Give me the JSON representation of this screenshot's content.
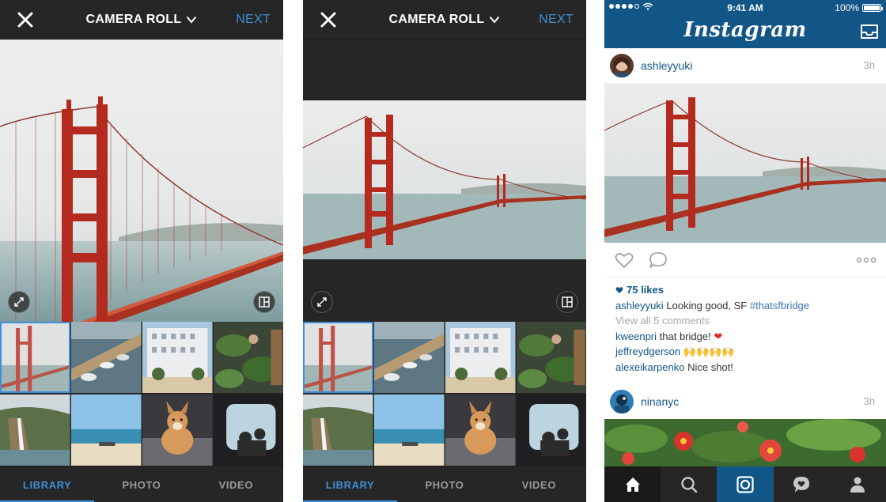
{
  "editor": {
    "title": "CAMERA ROLL",
    "next_label": "NEXT",
    "tabs": [
      {
        "label": "LIBRARY",
        "active": true
      },
      {
        "label": "PHOTO",
        "active": false
      },
      {
        "label": "VIDEO",
        "active": false
      }
    ],
    "icons": {
      "close": "close-icon",
      "title_dropdown": "chevron-down-icon",
      "expand": "expand-icon",
      "layout": "layout-icon"
    }
  },
  "feed": {
    "status_bar": {
      "time": "9:41 AM",
      "battery": "100%"
    },
    "app_name": "Instagram",
    "post1": {
      "username": "ashleyyuki",
      "time_ago": "3h",
      "likes": "75 likes",
      "caption_user": "ashleyyuki",
      "caption_text": "Looking good, SF",
      "caption_hashtag": "#thatsfbridge",
      "view_comments": "View all 5 comments",
      "comments": [
        {
          "user": "kweenpri",
          "text": "that bridge!",
          "emoji": "❤"
        },
        {
          "user": "jeffreydgerson",
          "text": "",
          "emoji": "🙌🙌🙌🙌"
        },
        {
          "user": "alexeikarpenko",
          "text": "Nice shot!",
          "emoji": ""
        }
      ]
    },
    "post2": {
      "username": "ninanyc",
      "time_ago": "3h"
    },
    "tab_icons": [
      "home-icon",
      "search-icon",
      "camera-icon",
      "activity-icon",
      "profile-icon"
    ]
  },
  "colors": {
    "accent_blue": "#3f8fd6",
    "instagram_blue": "#125688",
    "dark_background": "#262626",
    "bridge_red": "#b52a1e"
  }
}
